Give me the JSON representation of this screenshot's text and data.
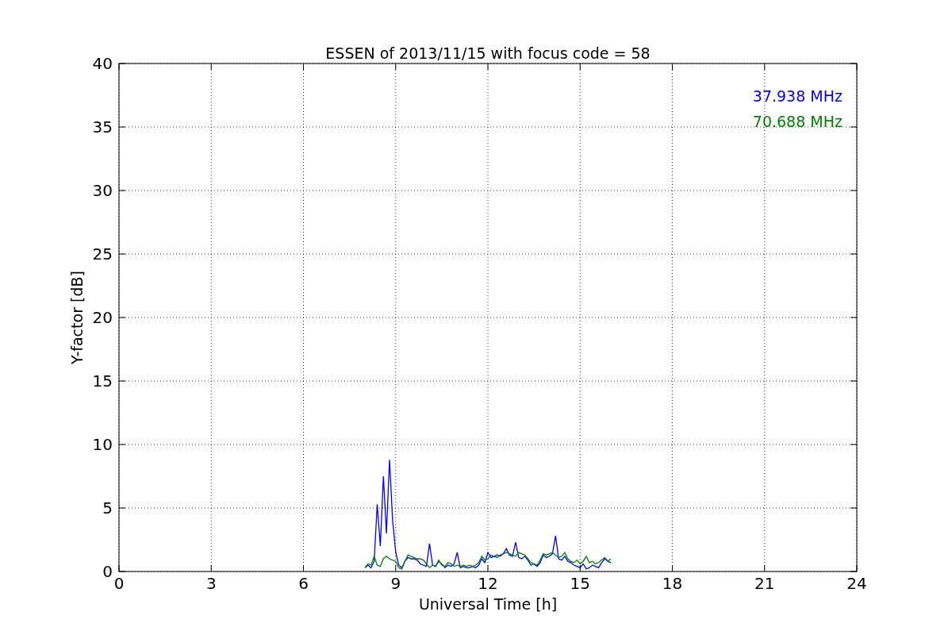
{
  "chart_data": {
    "type": "line",
    "title": "ESSEN of 2013/11/15 with focus code = 58",
    "xlabel": "Universal Time [h]",
    "ylabel": "Y-factor [dB]",
    "x": [
      8.0,
      8.1,
      8.2,
      8.3,
      8.4,
      8.5,
      8.6,
      8.7,
      8.8,
      8.9,
      9.0,
      9.1,
      9.2,
      9.3,
      9.4,
      9.5,
      9.6,
      9.7,
      9.8,
      9.9,
      10.0,
      10.1,
      10.2,
      10.3,
      10.4,
      10.5,
      10.6,
      10.7,
      10.8,
      10.9,
      11.0,
      11.1,
      11.2,
      11.3,
      11.4,
      11.5,
      11.6,
      11.7,
      11.8,
      11.9,
      12.0,
      12.1,
      12.2,
      12.3,
      12.4,
      12.5,
      12.6,
      12.7,
      12.8,
      12.9,
      13.0,
      13.1,
      13.2,
      13.3,
      13.4,
      13.5,
      13.6,
      13.7,
      13.8,
      13.9,
      14.0,
      14.1,
      14.2,
      14.3,
      14.4,
      14.5,
      14.6,
      14.7,
      14.8,
      14.9,
      15.0,
      15.1,
      15.2,
      15.3,
      15.4,
      15.5,
      15.6,
      15.7,
      15.8,
      15.9,
      16.0
    ],
    "series": [
      {
        "name": "37.938 MHz",
        "color": "#0000ff",
        "values": [
          0.3,
          0.5,
          0.3,
          0.8,
          5.3,
          2.0,
          7.5,
          3.0,
          8.8,
          4.0,
          1.5,
          0.5,
          0.3,
          0.8,
          1.1,
          1.0,
          1.0,
          0.9,
          0.6,
          0.5,
          0.4,
          2.2,
          0.5,
          0.4,
          0.8,
          0.6,
          0.3,
          0.5,
          0.4,
          0.6,
          1.5,
          0.3,
          0.4,
          0.3,
          0.3,
          0.4,
          0.3,
          0.5,
          1.0,
          0.7,
          1.5,
          1.1,
          1.2,
          1.3,
          1.2,
          1.4,
          1.8,
          1.3,
          1.2,
          2.3,
          1.1,
          1.0,
          1.2,
          0.9,
          0.5,
          0.6,
          0.4,
          0.7,
          1.3,
          1.1,
          1.2,
          1.4,
          2.8,
          1.0,
          0.9,
          1.2,
          0.8,
          0.7,
          0.5,
          0.4,
          0.3,
          0.6,
          0.2,
          0.3,
          0.5,
          0.4,
          0.3,
          0.7,
          1.0,
          0.8,
          0.7
        ]
      },
      {
        "name": "70.688 MHz",
        "color": "#008000",
        "values": [
          0.3,
          0.6,
          0.5,
          1.2,
          0.5,
          0.4,
          1.0,
          1.2,
          1.0,
          0.9,
          0.8,
          0.3,
          0.2,
          0.8,
          1.3,
          1.2,
          1.1,
          1.0,
          1.0,
          0.9,
          0.6,
          0.3,
          0.5,
          0.4,
          0.9,
          0.5,
          0.4,
          0.7,
          0.6,
          0.4,
          0.5,
          0.4,
          0.5,
          0.4,
          0.5,
          0.4,
          0.5,
          0.7,
          1.2,
          0.9,
          1.0,
          1.3,
          1.2,
          1.1,
          1.3,
          1.4,
          1.5,
          1.4,
          1.3,
          1.2,
          1.5,
          1.4,
          1.3,
          1.0,
          0.7,
          0.6,
          0.5,
          0.9,
          1.4,
          1.3,
          1.4,
          1.5,
          1.3,
          1.1,
          1.2,
          1.5,
          1.0,
          0.8,
          0.7,
          0.9,
          0.6,
          0.8,
          1.2,
          0.7,
          0.8,
          0.6,
          0.7,
          0.9,
          1.1,
          0.8,
          1.0
        ]
      }
    ],
    "xlim": [
      0,
      24
    ],
    "ylim": [
      0,
      40
    ],
    "xticks": [
      0,
      3,
      6,
      9,
      12,
      15,
      18,
      21,
      24
    ],
    "yticks": [
      0,
      5,
      10,
      15,
      20,
      25,
      30,
      35,
      40
    ],
    "grid": true
  }
}
